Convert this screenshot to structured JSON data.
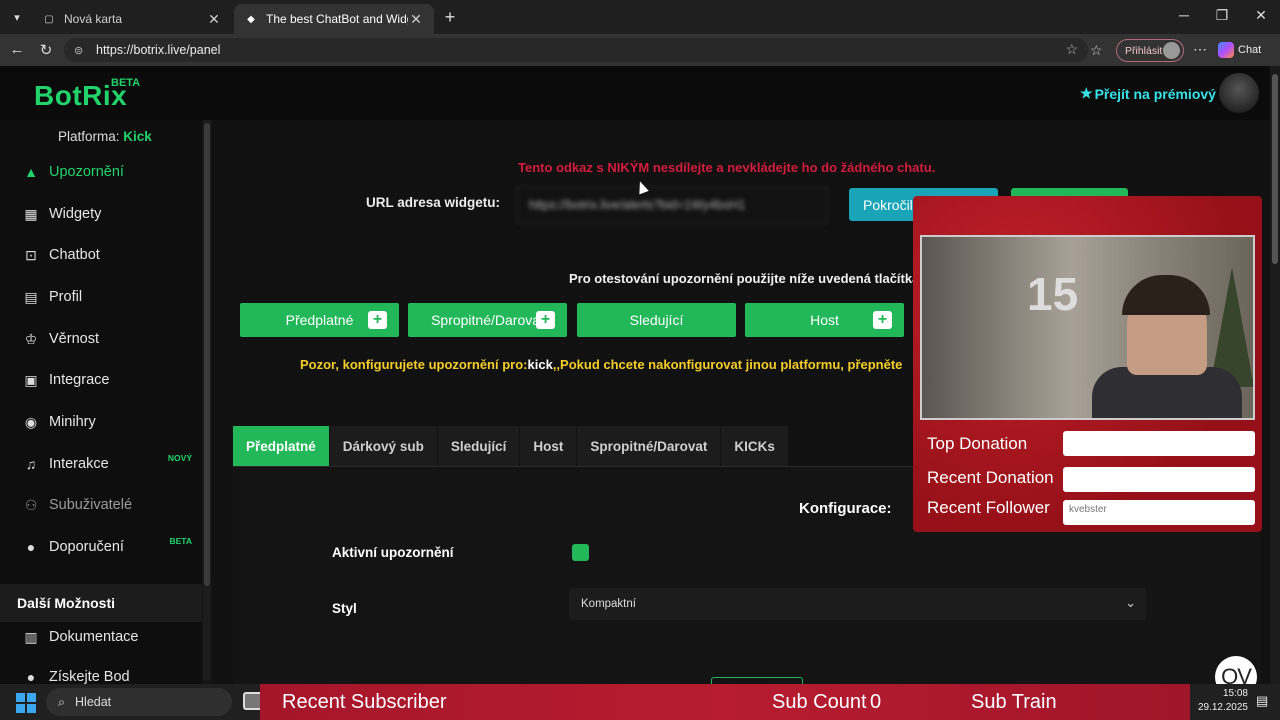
{
  "browser": {
    "tabs": [
      {
        "title": "Nová karta",
        "icon": "page-icon"
      },
      {
        "title": "The best ChatBot and Widgets for",
        "icon": "botrix-icon",
        "active": true
      }
    ],
    "url": "https://botrix.live/panel",
    "signin_label": "Přihlásit",
    "copilot_label": "Chat"
  },
  "header": {
    "logo": "BotRix",
    "logo_badge": "BETA",
    "premium_label": "Přejít na prémiový"
  },
  "sidebar": {
    "platform_label": "Platforma:",
    "platform_value": "Kick",
    "items": [
      {
        "label": "Upozornění",
        "icon": "warning-icon"
      },
      {
        "label": "Widgety",
        "icon": "widgets-icon"
      },
      {
        "label": "Chatbot",
        "icon": "robot-icon"
      },
      {
        "label": "Profil",
        "icon": "profile-card-icon"
      },
      {
        "label": "Věrnost",
        "icon": "trophy-icon"
      },
      {
        "label": "Integrace",
        "icon": "integration-icon"
      },
      {
        "label": "Minihry",
        "icon": "gamepad-icon"
      },
      {
        "label": "Interakce",
        "icon": "music-icon",
        "badge": "NOVÝ"
      },
      {
        "label": "Subuživatelé",
        "icon": "users-icon"
      },
      {
        "label": "Doporučení",
        "icon": "referral-icon",
        "badge": "BETA"
      }
    ],
    "more_section": "Další Možnosti",
    "more_items": [
      {
        "label": "Dokumentace",
        "icon": "book-icon"
      },
      {
        "label": "Získejte Bod",
        "icon": "coin-icon"
      }
    ]
  },
  "main": {
    "warning": "Tento odkaz s NIKÝM nesdílejte a nevkládejte ho do žádného chatu.",
    "url_label": "URL adresa widgetu:",
    "url_value": "https://botrix.live/alerts?bid=1Wy4bsH1",
    "advanced_button": "Pokročilé",
    "test_text": "Pro otestování upozornění použijte níže uvedená tlačítka",
    "test_buttons": [
      "Předplatné",
      "Spropitné/Darovat",
      "Sledující",
      "Host"
    ],
    "notice_pre": "Pozor, konfigurujete upozornění pro:",
    "notice_platform": "kick",
    "notice_post": ",,Pokud chcete nakonfigurovat jinou platformu, přepněte",
    "tabs": [
      "Předplatné",
      "Dárkový sub",
      "Sledující",
      "Host",
      "Spropitné/Darovat",
      "KICKs"
    ],
    "config_title": "Konfigurace:",
    "active_label": "Aktivní upozornění",
    "style_label": "Styl",
    "style_value": "Kompaktní",
    "ov_logo": "OV"
  },
  "overlay": {
    "top_donation": "Top Donation",
    "recent_donation": "Recent Donation",
    "recent_follower": "Recent Follower",
    "recent_follower_value": "kvebster",
    "balloon_number": "15"
  },
  "strip": {
    "recent_subscriber": "Recent Subscriber",
    "sub_count_label": "Sub Count",
    "sub_count_value": "0",
    "sub_train": "Sub Train"
  },
  "taskbar": {
    "search_placeholder": "Hledat",
    "time": "15:08",
    "date": "29.12.2025"
  },
  "colors": {
    "brand_green": "#22d36b",
    "button_green": "#22b85a",
    "warning_red": "#d41c3c",
    "notice_yellow": "#f5cd2a",
    "premium_cyan": "#38e2e8",
    "advanced_teal": "#1aa4b8"
  }
}
